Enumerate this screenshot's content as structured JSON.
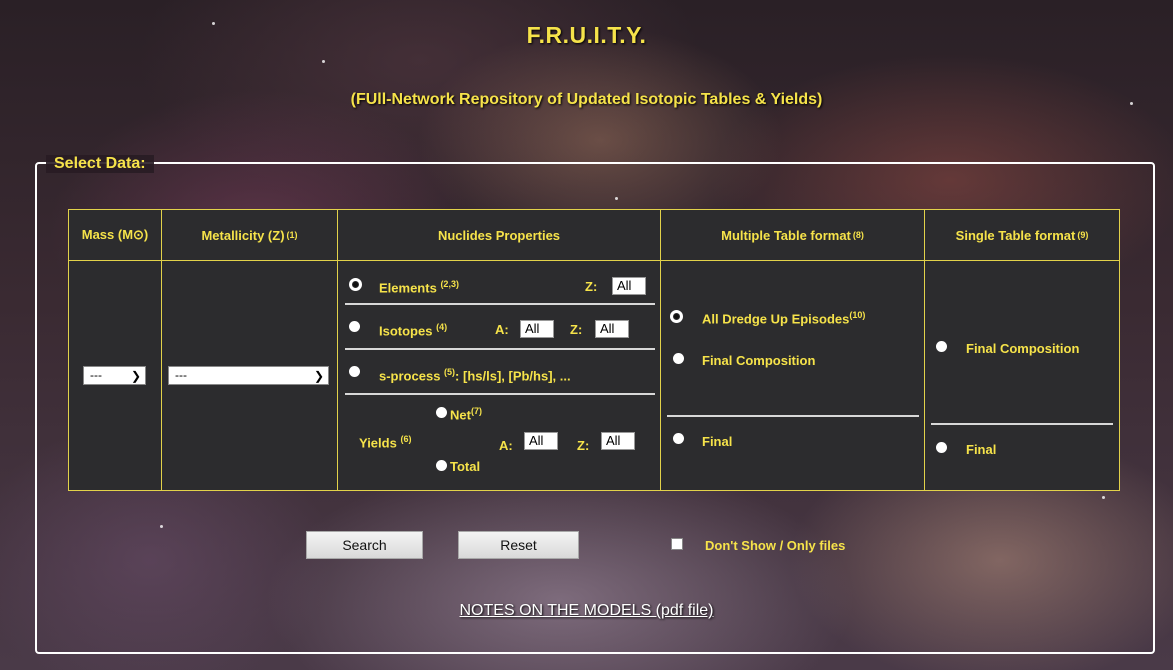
{
  "header": {
    "title": "F.R.U.I.T.Y.",
    "subtitle": "(FUll-Network Repository of Updated Isotopic Tables & Yields)"
  },
  "select_legend": "Select Data:",
  "columns": {
    "mass": {
      "label": "Mass (M⊙)",
      "value": "---"
    },
    "metallicity": {
      "label": "Metallicity (Z)",
      "sup": "(1)",
      "value": "---"
    },
    "nuclides": {
      "label": "Nuclides Properties"
    },
    "multiple": {
      "label": "Multiple Table format",
      "sup": "(8)"
    },
    "single": {
      "label": "Single Table format",
      "sup": "(9)"
    }
  },
  "nuclides": {
    "elements": {
      "label": "Elements",
      "sup": "(2,3)",
      "z_label": "Z:",
      "z_value": "All"
    },
    "isotopes": {
      "label": "Isotopes",
      "sup": "(4)",
      "a_label": "A:",
      "a_value": "All",
      "z_label": "Z:",
      "z_value": "All"
    },
    "sprocess": {
      "label": "s-process",
      "sup": "(5)",
      "suffix": ": [hs/ls], [Pb/hs], ..."
    },
    "yields": {
      "label": "Yields",
      "sup": "(6)",
      "net_label": "Net",
      "net_sup": "(7)",
      "total_label": "Total",
      "a_label": "A:",
      "a_value": "All",
      "z_label": "Z:",
      "z_value": "All"
    }
  },
  "multiple": {
    "all_dredge": {
      "label": "All Dredge Up Episodes",
      "sup": "(10)"
    },
    "final_composition": "Final Composition",
    "final": "Final"
  },
  "single": {
    "final_composition": "Final Composition",
    "final": "Final"
  },
  "actions": {
    "search": "Search",
    "reset": "Reset",
    "dont_show": "Don't Show / Only files"
  },
  "notes_link": "NOTES ON THE MODELS (pdf file)"
}
